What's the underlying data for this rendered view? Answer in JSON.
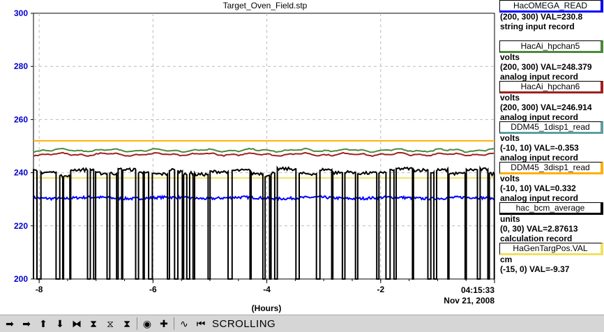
{
  "chart_data": {
    "type": "line",
    "title": "Target_Oven_Field.stp",
    "xlabel": "(Hours)",
    "ylabel": "",
    "x_ticks": [
      "-8",
      "-6",
      "-4",
      "-2"
    ],
    "x_end_label": "04:15:33",
    "date_label": "Nov 21, 2008",
    "ylim": [
      200,
      300
    ],
    "xlim": [
      -8.1,
      0
    ],
    "y_ticks": [
      "200",
      "220",
      "240",
      "260",
      "280",
      "300"
    ],
    "grid": true,
    "series": [
      {
        "name": "HacOMEGA_READ",
        "color": "#0000ff",
        "level": 230.5,
        "style": "noisy"
      },
      {
        "name": "HacAi_hpchan5",
        "color": "#4a8a3a",
        "level": 248.4,
        "style": "smooth"
      },
      {
        "name": "HacAi_hpchan6",
        "color": "#a02020",
        "level": 246.9,
        "style": "smooth"
      },
      {
        "name": "DDM45_1disp1_read",
        "color": "#ffb000",
        "level": 252,
        "style": "flat"
      },
      {
        "name": "DDM45_3disp1_read",
        "color": "#f0e060",
        "level": 238,
        "style": "flat"
      },
      {
        "name": "hac_bcm_average",
        "color": "#000000",
        "level": 240,
        "style": "spiky"
      }
    ]
  },
  "legend": [
    {
      "name": "HacOMEGA_READ",
      "color": "#0000ff",
      "lines": [
        "(200, 300) VAL=230.8",
        "string input record"
      ]
    },
    {
      "name": "HacAi_hpchan5",
      "color": "#4a8a3a",
      "lines": [
        "volts",
        "(200, 300) VAL=248.379",
        "analog input record"
      ]
    },
    {
      "name": "HacAi_hpchan6",
      "color": "#a02020",
      "lines": [
        "volts",
        "(200, 300) VAL=246.914",
        "analog input record"
      ]
    },
    {
      "name": "DDM45_1disp1_read",
      "color": "#5f9ea0",
      "lines": [
        "volts",
        "(-10, 10) VAL=-0.353",
        "analog input record"
      ]
    },
    {
      "name": "DDM45_3disp1_read",
      "color": "#ffb000",
      "lines": [
        "volts",
        "(-10, 10) VAL=0.332",
        "analog input record"
      ]
    },
    {
      "name": "hac_bcm_average",
      "color": "#000000",
      "lines": [
        "units",
        "(0, 30) VAL=2.87613",
        "calculation record"
      ]
    },
    {
      "name": "HaGenTargPos.VAL",
      "color": "#f0e060",
      "lines": [
        "cm",
        "(-15, 0) VAL=-9.37"
      ]
    }
  ],
  "toolbar": {
    "status": "SCROLLING",
    "icons": [
      "arrow-left-icon",
      "arrow-right-icon",
      "arrow-up-icon",
      "arrow-down-icon",
      "zoom-in-horizontal-icon",
      "zoom-out-horizontal-icon",
      "zoom-in-vertical-icon",
      "zoom-out-vertical-icon",
      "stop-icon",
      "add-icon",
      "waveform-icon",
      "go-to-now-icon"
    ],
    "glyphs": [
      "➡",
      "➡",
      "⬆",
      "⬇",
      "⧓",
      "⧗",
      "⧖",
      "⧗",
      "◉",
      "✚",
      "∿",
      "⏮"
    ]
  },
  "axis_color": "#0000cc"
}
